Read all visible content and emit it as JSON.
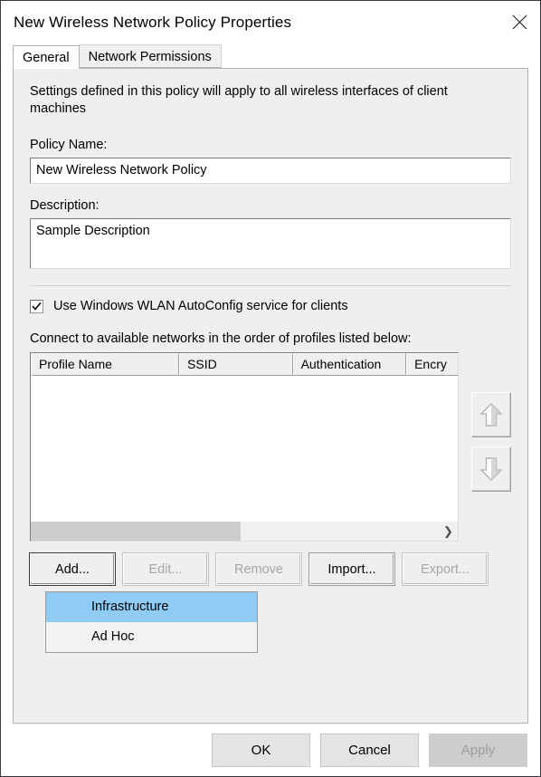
{
  "window": {
    "title": "New Wireless Network Policy Properties",
    "close_icon": "close-icon"
  },
  "tabs": [
    {
      "label": "General",
      "active": true
    },
    {
      "label": "Network Permissions",
      "active": false
    }
  ],
  "general": {
    "intro_text": "Settings defined in this policy will apply to all wireless interfaces of client machines",
    "policy_name_label": "Policy Name:",
    "policy_name_value": "New Wireless Network Policy",
    "description_label": "Description:",
    "description_value": "Sample Description",
    "autoconfig_checkbox_label": "Use Windows WLAN AutoConfig service for clients",
    "autoconfig_checked": true,
    "list_label": "Connect to available networks in the order of profiles listed below:"
  },
  "profile_list": {
    "columns": [
      "Profile Name",
      "SSID",
      "Authentication",
      "Encry"
    ],
    "rows": [],
    "scroll_right_arrow": "chevron-right-icon"
  },
  "reorder_buttons": [
    {
      "name": "move-up-button",
      "icon": "arrow-up-icon",
      "enabled": false
    },
    {
      "name": "move-down-button",
      "icon": "arrow-down-icon",
      "enabled": false
    }
  ],
  "profile_actions": [
    {
      "label": "Add...",
      "enabled": true,
      "default": true
    },
    {
      "label": "Edit...",
      "enabled": false,
      "default": false
    },
    {
      "label": "Remove",
      "enabled": false,
      "default": false
    },
    {
      "label": "Import...",
      "enabled": true,
      "default": false
    },
    {
      "label": "Export...",
      "enabled": false,
      "default": false
    }
  ],
  "dropdown": {
    "items": [
      {
        "label": "Infrastructure",
        "selected": true
      },
      {
        "label": "Ad Hoc",
        "selected": false
      }
    ]
  },
  "footer": {
    "ok_label": "OK",
    "cancel_label": "Cancel",
    "apply_label": "Apply",
    "apply_enabled": false
  },
  "colors": {
    "dialog_bg": "#ffffff",
    "panel_bg": "#efefef",
    "highlight": "#8fcbf5",
    "disabled_text": "#a6a6a6",
    "frame": "#3a3a44"
  }
}
